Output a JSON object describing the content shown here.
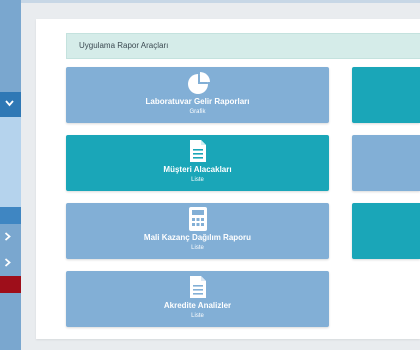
{
  "header": {
    "title": "Uygulama Rapor Araçları"
  },
  "tiles": [
    {
      "title": "Laboratuvar Gelir Raporları",
      "subtitle": "Grafik",
      "icon": "pie-chart-icon"
    },
    {
      "title": "Müşteri Alacakları",
      "subtitle": "Liste",
      "icon": "document-icon"
    },
    {
      "title": "Mali Kazanç Dağılım Raporu",
      "subtitle": "Liste",
      "icon": "calculator-icon"
    },
    {
      "title": "Akredite Analizler",
      "subtitle": "Liste",
      "icon": "document-icon"
    }
  ],
  "colors": {
    "tile_light": "#82afd6",
    "tile_teal": "#1aa6b8",
    "sidebar": "#7aa7cf",
    "sidebar_active": "#2f78b5",
    "sidebar_alert": "#9e0e1a",
    "header_bar": "#d5ece9"
  }
}
